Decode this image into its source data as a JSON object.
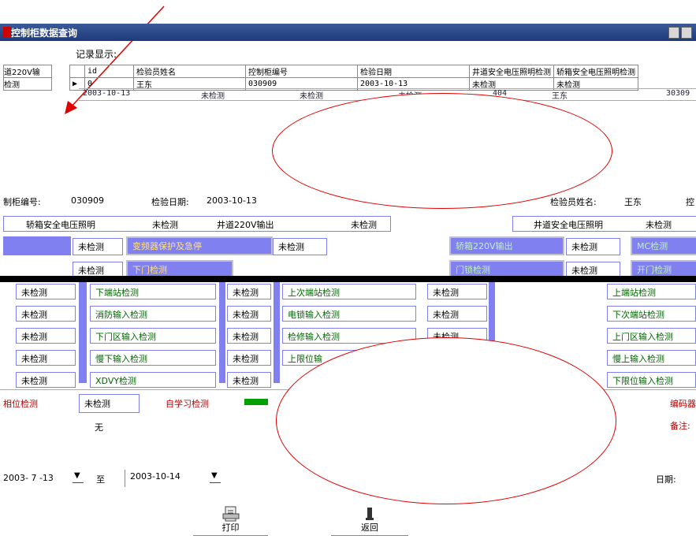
{
  "window": {
    "title": "控制柜数据查询"
  },
  "grid": {
    "section_label": "记录显示:",
    "left_frag_header": "道220V输",
    "left_frag_value": "检测",
    "columns": [
      "id",
      "检验员姓名",
      "控制柜编号",
      "检验日期",
      "井道安全电压照明检测",
      "轿箱安全电压照明检测",
      "检测"
    ],
    "row1": [
      "0",
      "王东",
      "030909",
      "2003-10-13",
      "未检测",
      "未检测"
    ],
    "row2": [
      "2003-10-13",
      "未检测",
      "未检测",
      "未检测",
      "404",
      "王东",
      "30309"
    ]
  },
  "info": {
    "cabinet_label": "制柜编号:",
    "cabinet_value": "030909",
    "date_label": "检验日期:",
    "date_value": "2003-10-13",
    "inspector_label": "检验员姓名:",
    "inspector_value": "王东",
    "trailing": "控"
  },
  "top_row": {
    "a": "轿箱安全电压照明",
    "b": "未检测",
    "c": "井道220V输出",
    "d": "未检测",
    "e": "井道安全电压照明",
    "f": "未检测"
  },
  "row_a": {
    "status1": "未检测",
    "label1": "变频器保护及急停",
    "status2": "未检测",
    "label2": "轿箱220V输出",
    "status3": "未检测",
    "label3": "MC检测"
  },
  "row_b": {
    "status": "未检测",
    "label1": "下门检测",
    "label2": "门锁检测",
    "status2": "未检测",
    "label3": "开门检测"
  },
  "col1_status": [
    "未检测",
    "未检测",
    "未检测",
    "未检测",
    "未检测"
  ],
  "col2_labels": [
    "下端站检测",
    "消防输入检测",
    "下门区输入检测",
    "慢下输入检测",
    "XDVY检测"
  ],
  "col3_status": [
    "未检测",
    "未检测",
    "未检测",
    "未检测",
    "未检测"
  ],
  "col4_labels": [
    "上次端站检测",
    "电锁输入检测",
    "检修输入检测",
    "上限位输"
  ],
  "col5_status": [
    "未检测",
    "未检测",
    "未检测"
  ],
  "col6_labels": [
    "上端站检测",
    "下次端站检测",
    "上门区输入检测",
    "慢上输入检测",
    "下限位输入检测"
  ],
  "bottom": {
    "phase_label": "相位检测",
    "phase_value": "未检测",
    "self_learn_label": "自学习检测",
    "none_value": "无",
    "encoder_label": "编码器",
    "note_label": "备注:"
  },
  "date_range": {
    "start": "2003- 7 -13",
    "to": "至",
    "end": "2003-10-14",
    "date_label": "日期:"
  },
  "toolbar": {
    "print_label": "打印",
    "back_label": "返回"
  },
  "annotation": {
    "arrow_color": "#e00000"
  }
}
